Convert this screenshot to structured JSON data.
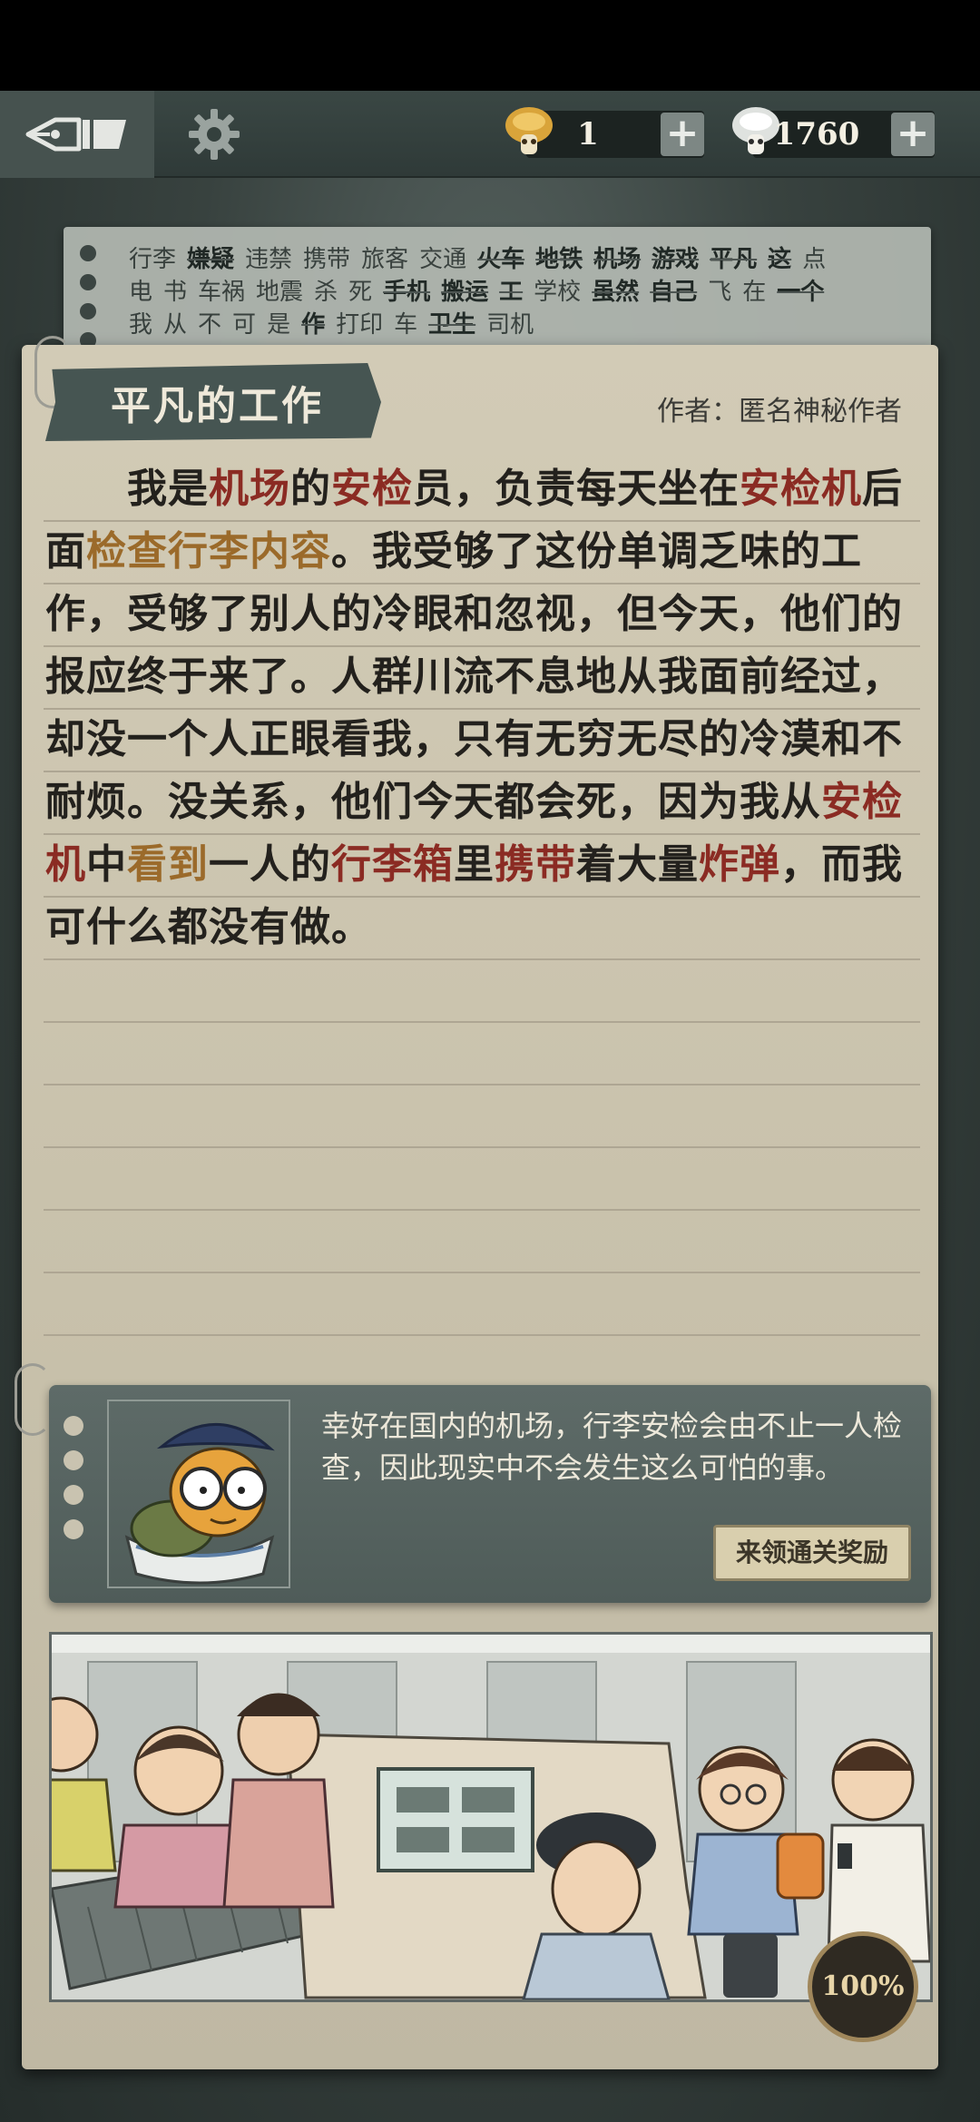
{
  "top_bar": {
    "coins_value": "1",
    "gems_value": "1760",
    "plus_label": "+"
  },
  "keywords": {
    "lines": [
      [
        {
          "text": "行李",
          "found": false
        },
        {
          "text": "嫌疑",
          "found": true
        },
        {
          "text": "违禁",
          "found": false
        },
        {
          "text": "携带",
          "found": false
        },
        {
          "text": "旅客",
          "found": false
        },
        {
          "text": "交通",
          "found": false
        },
        {
          "text": "火车",
          "found": true
        },
        {
          "text": "地铁",
          "found": true
        },
        {
          "text": "机场",
          "found": true
        },
        {
          "text": "游戏",
          "found": true
        },
        {
          "text": "平凡",
          "found": true
        },
        {
          "text": "这",
          "found": true
        },
        {
          "text": "点",
          "found": false
        }
      ],
      [
        {
          "text": "电",
          "found": false
        },
        {
          "text": "书",
          "found": false
        },
        {
          "text": "车祸",
          "found": false
        },
        {
          "text": "地震",
          "found": false
        },
        {
          "text": "杀",
          "found": false
        },
        {
          "text": "死",
          "found": false
        },
        {
          "text": "手机",
          "found": true
        },
        {
          "text": "搬运",
          "found": true
        },
        {
          "text": "工",
          "found": true
        },
        {
          "text": "学校",
          "found": false
        },
        {
          "text": "虽然",
          "found": true
        },
        {
          "text": "自己",
          "found": true
        },
        {
          "text": "飞",
          "found": false
        },
        {
          "text": "在",
          "found": false
        },
        {
          "text": "一个",
          "found": true
        }
      ],
      [
        {
          "text": "我",
          "found": false
        },
        {
          "text": "从",
          "found": false
        },
        {
          "text": "不",
          "found": false
        },
        {
          "text": "可",
          "found": false
        },
        {
          "text": "是",
          "found": false
        },
        {
          "text": "作",
          "found": true
        },
        {
          "text": "打印",
          "found": false
        },
        {
          "text": "车",
          "found": false
        },
        {
          "text": "卫生",
          "found": true
        },
        {
          "text": "司机",
          "found": false
        }
      ]
    ]
  },
  "story": {
    "title": "平凡的工作",
    "author": "作者：匿名神秘作者",
    "segments": [
      {
        "text": "我是",
        "hl": ""
      },
      {
        "text": "机场",
        "hl": "red"
      },
      {
        "text": "的",
        "hl": ""
      },
      {
        "text": "安检",
        "hl": "red"
      },
      {
        "text": "员，负责每天坐在",
        "hl": ""
      },
      {
        "text": "安检机",
        "hl": "red"
      },
      {
        "text": "后面",
        "hl": ""
      },
      {
        "text": "检查行李内容",
        "hl": "gold"
      },
      {
        "text": "。我受够了这份单调乏味的工作，受够了别人的冷眼和忽视，但今天，他们的报应终于来了。人群川流不息地从我面前经过，却没一个人正眼看我，只有无穷无尽的冷漠和不耐烦。没关系，他们今天都会死，因为我从",
        "hl": ""
      },
      {
        "text": "安检机",
        "hl": "red"
      },
      {
        "text": "中",
        "hl": ""
      },
      {
        "text": "看到",
        "hl": "gold"
      },
      {
        "text": "一人的",
        "hl": ""
      },
      {
        "text": "行李箱",
        "hl": "red"
      },
      {
        "text": "里",
        "hl": ""
      },
      {
        "text": "携带",
        "hl": "red"
      },
      {
        "text": "着大量",
        "hl": ""
      },
      {
        "text": "炸弹",
        "hl": "red"
      },
      {
        "text": "，而我可什么都没有做。",
        "hl": ""
      }
    ]
  },
  "tip": {
    "text": "幸好在国内的机场，行李安检会由不止一人检查，因此现实中不会发生这么可怕的事。",
    "reward_button": "来领通关奖励"
  },
  "progress": {
    "label": "100%"
  },
  "colors": {
    "highlight_red": "#8b2b23",
    "highlight_gold": "#9b6a2a",
    "paper": "#cdc6b1",
    "header": "#465552"
  }
}
